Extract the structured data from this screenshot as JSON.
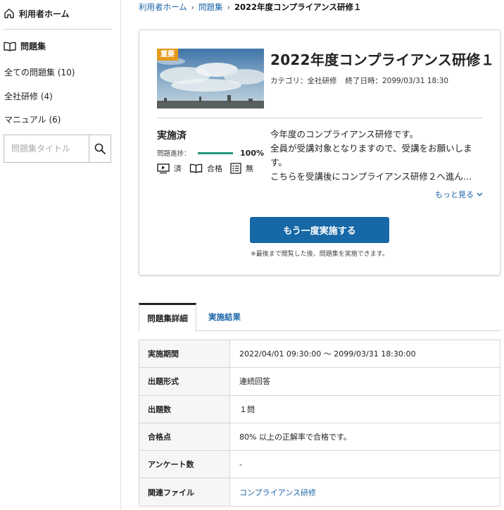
{
  "sidebar": {
    "home_label": "利用者ホーム",
    "section_label": "問題集",
    "items": [
      {
        "label": "全ての問題集 (10)"
      },
      {
        "label": "全社研修 (4)"
      },
      {
        "label": "マニュアル (6)"
      }
    ],
    "search_placeholder": "問題集タイトル"
  },
  "breadcrumb": {
    "items": [
      "利用者ホーム",
      "問題集"
    ],
    "current": "2022年度コンプライアンス研修１"
  },
  "course": {
    "badge": "重要",
    "title": "2022年度コンプライアンス研修１",
    "category": "カテゴリ：全社研修",
    "end_date": "終了日時：2099/03/31 18:30",
    "status": "実施済",
    "progress_label": "問題進捗：",
    "progress_value": "100%",
    "progress_fraction": 1.0,
    "video_status": "済",
    "test_status": "合格",
    "survey_status": "無",
    "description_lines": [
      "今年度のコンプライアンス研修です。",
      "全員が受講対象となりますので、受講をお願いしま",
      "す。",
      "こちらを受講後にコンプライアンス研修２へ進ん…"
    ],
    "more_label": "もっと見る",
    "retry_button": "もう一度実施する",
    "note": "※最後まで閲覧した後、問題集を実施できます。"
  },
  "tabs": [
    {
      "label": "問題集詳細"
    },
    {
      "label": "実施結果"
    }
  ],
  "details": {
    "rows": [
      {
        "key": "実施期間",
        "value": "2022/04/01 09:30:00 〜 2099/03/31 18:30:00"
      },
      {
        "key": "出題形式",
        "value": "連続回答"
      },
      {
        "key": "出題数",
        "value": "１問"
      },
      {
        "key": "合格点",
        "value": "80% 以上の正解率で合格です。"
      },
      {
        "key": "アンケート数",
        "value": "-"
      },
      {
        "key": "関連ファイル",
        "value": "コンプライアンス研修"
      }
    ]
  },
  "colors": {
    "link": "#1a66a8",
    "primary_button": "#1668a6",
    "badge": "#e59a1d",
    "progress": "#239a7a"
  }
}
